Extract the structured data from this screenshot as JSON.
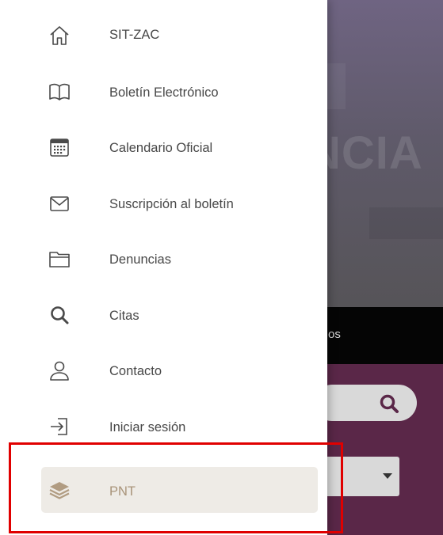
{
  "background": {
    "heading_fragment": "NCIA",
    "tab_fragment": "os",
    "colors": {
      "header": "#6f6482",
      "tabbar": "#050505",
      "filter_panel": "#5a2748"
    }
  },
  "drawer": {
    "items": [
      {
        "label": "SIT-ZAC",
        "icon": "home-icon"
      },
      {
        "label": "Boletín Electrónico",
        "icon": "book-open-icon"
      },
      {
        "label": "Calendario Oficial",
        "icon": "calendar-icon"
      },
      {
        "label": "Suscripción al boletín",
        "icon": "envelope-icon"
      },
      {
        "label": "Denuncias",
        "icon": "folder-icon"
      },
      {
        "label": "Citas",
        "icon": "search-icon"
      },
      {
        "label": "Contacto",
        "icon": "user-icon"
      },
      {
        "label": "Iniciar sesión",
        "icon": "login-icon"
      },
      {
        "label": "PNT",
        "icon": "layers-icon",
        "selected": true
      }
    ],
    "colors": {
      "selected_bg": "#eeebe6",
      "selected_text": "#a89379",
      "text": "#474747",
      "highlight": "#e00000"
    }
  }
}
